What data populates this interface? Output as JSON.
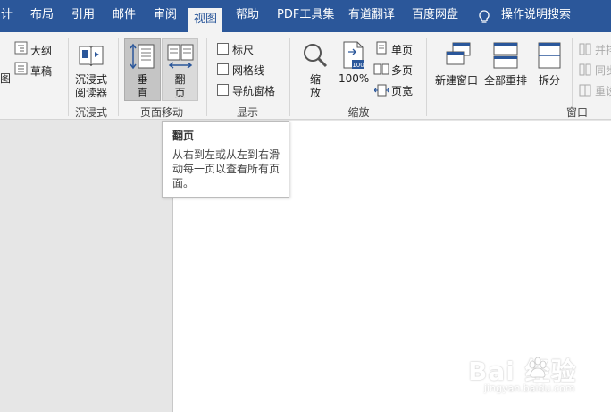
{
  "tabs": [
    "计",
    "布局",
    "引用",
    "邮件",
    "审阅",
    "视图",
    "帮助",
    "PDF工具集",
    "有道翻译",
    "百度网盘"
  ],
  "tell_me": {
    "label": "操作说明搜索",
    "icon": "lightbulb-icon"
  },
  "ribbon": {
    "views": {
      "left_cut": "图",
      "outline": "大纲",
      "draft": "草稿"
    },
    "immersive": {
      "reader_line1": "沉浸式",
      "reader_line2": "阅读器",
      "group": "沉浸式"
    },
    "page_movement": {
      "vertical_line1": "垂",
      "vertical_line2": "直",
      "side_line1": "翻",
      "side_line2": "页",
      "group": "页面移动"
    },
    "show": {
      "ruler": "标尺",
      "gridlines": "网格线",
      "nav_pane": "导航窗格",
      "group": "显示"
    },
    "zoom": {
      "zoom_line1": "缩",
      "zoom_line2": "放",
      "percent": "100%",
      "single": "单页",
      "multi": "多页",
      "width": "页宽",
      "group": "缩放",
      "icon_badge": "100"
    },
    "window": {
      "new": "新建窗口",
      "arrange": "全部重排",
      "split": "拆分",
      "side_by_side": "并排",
      "sync": "同步",
      "reset": "重设",
      "group": "窗口"
    }
  },
  "tooltip": {
    "title": "翻页",
    "body": "从右到左或从左到右滑动每一页以查看所有页面。"
  },
  "watermark": {
    "main": "Bai 经验",
    "sub": "jingyan.baidu.com",
    "paw_icon": "baidu-paw-icon"
  },
  "colors": {
    "tab_bar": "#2b579a",
    "ribbon": "#f3f3f3",
    "canvas": "#e6e6e6",
    "accent": "#2b579a"
  }
}
